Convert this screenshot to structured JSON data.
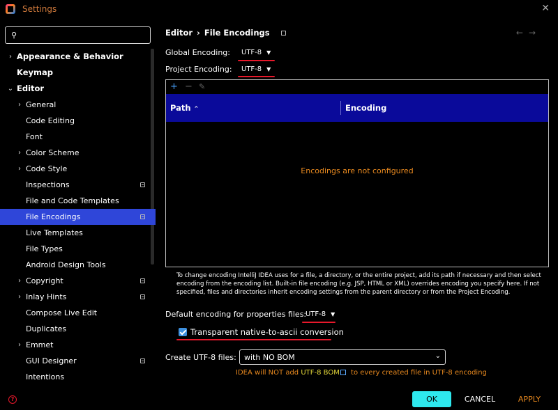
{
  "window": {
    "title": "Settings"
  },
  "sidebar": {
    "search_placeholder": "",
    "items": [
      {
        "label": "Appearance & Behavior",
        "expander": "›"
      },
      {
        "label": "Keymap"
      },
      {
        "label": "Editor",
        "expander": "⌄"
      },
      {
        "label": "General",
        "expander": "›"
      },
      {
        "label": "Code Editing"
      },
      {
        "label": "Font"
      },
      {
        "label": "Color Scheme",
        "expander": "›"
      },
      {
        "label": "Code Style",
        "expander": "›"
      },
      {
        "label": "Inspections"
      },
      {
        "label": "File and Code Templates"
      },
      {
        "label": "File Encodings"
      },
      {
        "label": "Live Templates"
      },
      {
        "label": "File Types"
      },
      {
        "label": "Android Design Tools"
      },
      {
        "label": "Copyright",
        "expander": "›"
      },
      {
        "label": "Inlay Hints",
        "expander": "›"
      },
      {
        "label": "Compose Live Edit"
      },
      {
        "label": "Duplicates"
      },
      {
        "label": "Emmet",
        "expander": "›"
      },
      {
        "label": "GUI Designer"
      },
      {
        "label": "Intentions"
      }
    ]
  },
  "breadcrumb": {
    "parent": "Editor",
    "separator": "›",
    "current": "File Encodings"
  },
  "nav": {
    "back": "←",
    "forward": "→"
  },
  "encoding": {
    "global_label": "Global Encoding:",
    "global_value": "UTF-8",
    "project_label": "Project Encoding:",
    "project_value": "UTF-8",
    "combo_arrow": "▼"
  },
  "table": {
    "toolbar": {
      "add": "+",
      "remove": "−",
      "edit": "✎"
    },
    "col_path": "Path",
    "sort_indicator": "⌃",
    "col_encoding": "Encoding",
    "empty_text": "Encodings are not configured"
  },
  "help_text": "To change encoding IntelliJ IDEA uses for a file, a directory, or the entire project, add its path if necessary and then select encoding from the encoding list. Built-in file encoding (e.g. JSP, HTML or XML) overrides encoding you specify here. If not specified, files and directories inherit encoding settings from the parent directory or from the Project Encoding.",
  "properties": {
    "label": "Default encoding for properties files:",
    "value": "UTF-8",
    "checkbox_label": "Transparent native-to-ascii conversion",
    "checked": true
  },
  "bom": {
    "label": "Create UTF-8 files:",
    "value": "with NO BOM",
    "chevron": "⌄",
    "note_prefix": "IDEA will NOT add ",
    "note_highlight": "UTF-8 BOM",
    "note_suffix": " to every created file in UTF-8 encoding"
  },
  "footer": {
    "help": "?",
    "ok": "OK",
    "cancel": "CANCEL",
    "apply": "APPLY"
  },
  "colors": {
    "selection": "#2f46d9",
    "table_header": "#0a0a9a",
    "warning_orange": "#e8891f",
    "ok_button": "#2ee8ee",
    "annotation_red": "#e8182b"
  }
}
